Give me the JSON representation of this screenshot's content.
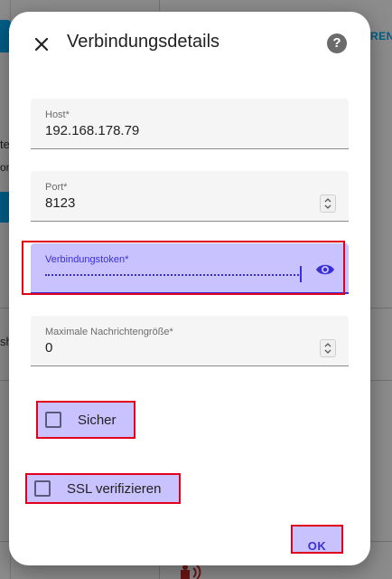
{
  "background": {
    "right_label": "REN",
    "left_fragments": [
      "te",
      "on",
      "sh"
    ]
  },
  "dialog": {
    "title": "Verbindungsdetails",
    "help_label": "?",
    "fields": {
      "host": {
        "label": "Host*",
        "value": "192.168.178.79"
      },
      "port": {
        "label": "Port*",
        "value": "8123"
      },
      "token": {
        "label": "Verbindungstoken*"
      },
      "max_size": {
        "label": "Maximale Nachrichtengröße*",
        "value": "0"
      }
    },
    "checkboxes": {
      "secure": {
        "label": "Sicher",
        "checked": false
      },
      "verify_ssl": {
        "label": "SSL verifizieren",
        "checked": false
      }
    },
    "ok_label": "OK"
  },
  "colors": {
    "accent": "#3a2fd6",
    "highlight": "#c8c3ff",
    "outline": "#e0001a",
    "brand_blue": "#03a9f4"
  }
}
